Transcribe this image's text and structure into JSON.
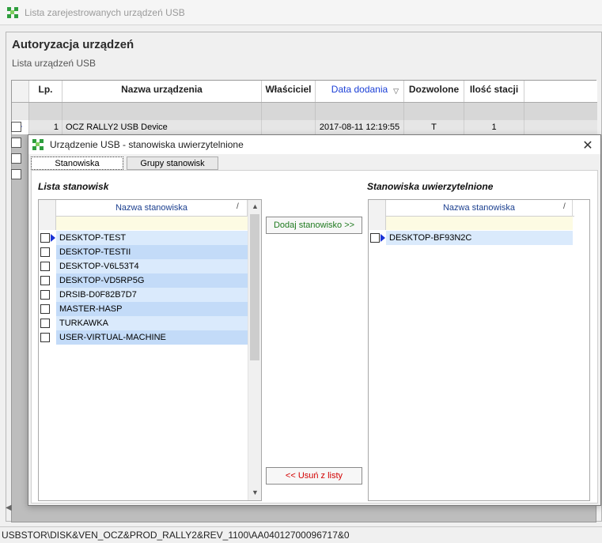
{
  "main_window": {
    "title": "Lista zarejestrowanych urządzeń USB"
  },
  "panel": {
    "title": "Autoryzacja urządzeń",
    "subtitle": "Lista urządzeń USB"
  },
  "grid": {
    "columns": [
      "Lp.",
      "Nazwa urządzenia",
      "Właściciel",
      "Data dodania",
      "Dozwolone",
      "Ilość stacji"
    ],
    "sorted_column_color": "#1b3fd6",
    "rows": [
      {
        "lp": "1",
        "name": "OCZ RALLY2 USB Device",
        "owner": "",
        "date": "2017-08-11 12:19:55",
        "allowed": "T",
        "stations": "1"
      }
    ]
  },
  "statusbar": {
    "text": "USBSTOR\\DISK&VEN_OCZ&PROD_RALLY2&REV_1100\\AA04012700096717&0"
  },
  "dialog": {
    "title": "Urządzenie USB - stanowiska uwierzytelnione",
    "close_icon": "close-icon",
    "tabs": [
      "Stanowiska",
      "Grupy stanowisk"
    ],
    "active_tab": "Stanowiska",
    "left": {
      "title": "Lista stanowisk",
      "column_header": "Nazwa stanowiska",
      "sort_marker": "/",
      "items": [
        "DESKTOP-TEST",
        "DESKTOP-TESTII",
        "DESKTOP-V6L53T4",
        "DESKTOP-VD5RP5G",
        "DRSIB-D0F82B7D7",
        "MASTER-HASP",
        "TURKAWKA",
        "USER-VIRTUAL-MACHINE"
      ]
    },
    "right": {
      "title": "Stanowiska uwierzytelnione",
      "column_header": "Nazwa stanowiska",
      "sort_marker": "/",
      "items": [
        "DESKTOP-BF93N2C"
      ]
    },
    "buttons": {
      "add": "Dodaj stanowisko >>",
      "remove": "<<  Usuń z listy"
    }
  }
}
